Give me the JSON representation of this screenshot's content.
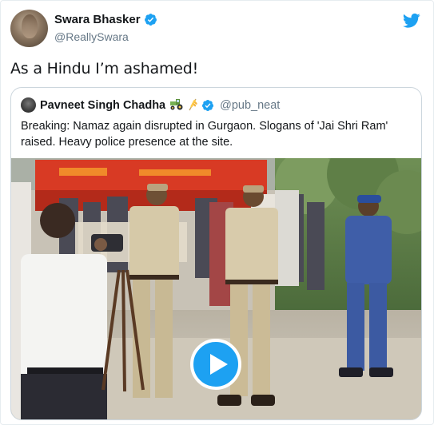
{
  "author": {
    "display_name": "Swara Bhasker",
    "handle": "@ReallySwara",
    "verified": true
  },
  "tweet": {
    "text": "As a Hindu I’m ashamed!"
  },
  "quoted_tweet": {
    "display_name": "Pavneet Singh Chadha",
    "emojis": [
      "tractor-emoji",
      "wheat-emoji"
    ],
    "handle": "@pub_neat",
    "verified": true,
    "text": "Breaking: Namaz again disrupted in Gurgaon. Slogans of 'Jai Shri Ram' raised. Heavy police presence at the site.",
    "media": {
      "type": "video",
      "play_icon": "play-icon"
    }
  },
  "icons": {
    "brand": "twitter-bird-icon",
    "verified": "verified-badge-icon"
  },
  "colors": {
    "accent": "#1da1f2",
    "text": "#14171a",
    "secondary_text": "#657786",
    "border": "#ccd6dd"
  }
}
